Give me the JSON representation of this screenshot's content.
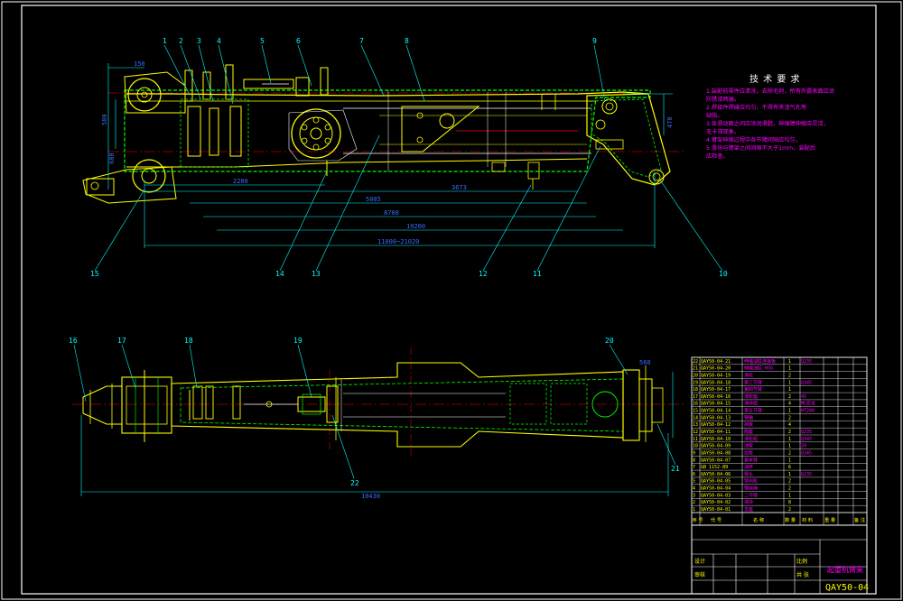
{
  "colors": {
    "background": "#000000",
    "frame": "#ffffff",
    "part_yellow": "#ffff00",
    "part_green": "#00ff00",
    "dimension_cyan": "#00ffff",
    "center_red": "#ff0000",
    "text_magenta": "#ff00ff",
    "dimension_blue": "#3b6bff"
  },
  "top_view": {
    "balloons": [
      "1",
      "2",
      "3",
      "4",
      "5",
      "6",
      "7",
      "8",
      "9",
      "10",
      "11",
      "12",
      "13",
      "14",
      "15"
    ],
    "dimensions": {
      "d_left_top": "150",
      "d_left_a": "580",
      "d_left_b": "680",
      "d_right": "470",
      "d_0": "2200",
      "d_1": "3673",
      "d_2": "5005",
      "d_3": "8700",
      "d_4": "10200",
      "d_5": "11000~21020"
    }
  },
  "bottom_view": {
    "balloons": [
      "16",
      "17",
      "18",
      "19",
      "20",
      "21",
      "22"
    ],
    "dimensions": {
      "d_right_top": "560",
      "d_overall": "10430"
    }
  },
  "technical_requirements": {
    "title": "技 术 要 求",
    "items": [
      "1.装配前零件应清洗，去除毛刺，所有外露表面应涂",
      "防锈漆两遍。",
      "2.焊接件焊缝应均匀，不得有夹渣气孔等",
      "缺陷。",
      "3.各滑动面之间应涂润滑脂，伸缩臂伸缩应灵活，",
      "无卡滞现象。",
      "4.臂架伸缩过程中各节臂间隙应均匀，",
      "5.滑块与臂架之间间隙不大于1mm，装配后",
      "应检查。"
    ]
  },
  "parts_table": {
    "rows": [
      {
        "code": "QAY50-04-21",
        "name": "伸缩油缸连接板",
        "qty": "1",
        "material": "Q235"
      },
      {
        "code": "QAY50-04-20",
        "name": "伸缩油缸 HSG",
        "qty": "1",
        "material": ""
      },
      {
        "code": "QAY50-04-19",
        "name": "滑轮",
        "qty": "2",
        "material": ""
      },
      {
        "code": "QAY50-04-18",
        "name": "第三节臂",
        "qty": "1",
        "material": "Q345"
      },
      {
        "code": "QAY50-04-17",
        "name": "第四节臂",
        "qty": "1",
        "material": ""
      },
      {
        "code": "QAY50-04-16",
        "name": "滑轮轴",
        "qty": "2",
        "material": "45"
      },
      {
        "code": "QAY50-04-15",
        "name": "滑块组",
        "qty": "4",
        "material": "MC尼龙"
      },
      {
        "code": "QAY50-04-14",
        "name": "第五节臂",
        "qty": "1",
        "material": "HT200"
      },
      {
        "code": "QAY50-04-13",
        "name": "销轴",
        "qty": "2",
        "material": ""
      },
      {
        "code": "QAY50-04-12",
        "name": "挡板",
        "qty": "4",
        "material": ""
      },
      {
        "code": "QAY50-04-11",
        "name": "隔套",
        "qty": "2",
        "material": "Q235"
      },
      {
        "code": "QAY50-04-10",
        "name": "滑轮组",
        "qty": "1",
        "material": "Q345"
      },
      {
        "code": "QAY50-04-09",
        "name": "油管",
        "qty": "1",
        "material": "20"
      },
      {
        "code": "QAY50-04-08",
        "name": "拉板",
        "qty": "2",
        "material": "Q345"
      },
      {
        "code": "QAY50-04-07",
        "name": "基本臂",
        "qty": "1",
        "material": ""
      },
      {
        "code": "GB 1152-89",
        "name": "油杯",
        "qty": "6",
        "material": ""
      },
      {
        "code": "QAY50-04-06",
        "name": "臂头",
        "qty": "1",
        "material": "Q235"
      },
      {
        "code": "QAY50-04-05",
        "name": "导向轮",
        "qty": "2",
        "material": ""
      },
      {
        "code": "QAY50-04-04",
        "name": "钢丝绳",
        "qty": "2",
        "material": ""
      },
      {
        "code": "QAY50-04-03",
        "name": "二节臂",
        "qty": "1",
        "material": ""
      },
      {
        "code": "QAY50-04-02",
        "name": "滑块",
        "qty": "8",
        "material": ""
      },
      {
        "code": "QAY50-04-01",
        "name": "支座",
        "qty": "2",
        "material": ""
      }
    ],
    "header": {
      "seq": "序 号",
      "code": "代 号",
      "name": "名 称",
      "qty": "数 量",
      "material": "材 料",
      "weight": "重 量",
      "remark": "备 注"
    }
  },
  "title_block": {
    "drawing_name": "起重机臂架",
    "drawing_code": "QAY50-04",
    "scale_label": "比例",
    "sheet_label": "共 张",
    "design_label": "设计",
    "check_label": "审核"
  }
}
